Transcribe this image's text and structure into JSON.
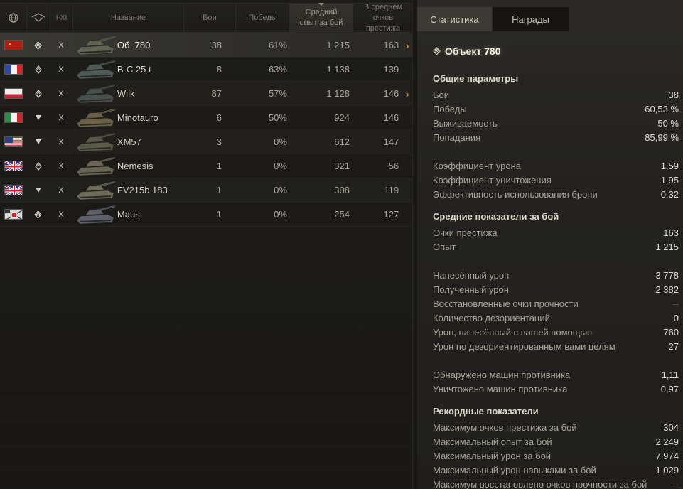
{
  "table": {
    "headers": {
      "nation_icon": "globe-icon",
      "type_icon": "vehicle-type-icon",
      "tier": "I-XI",
      "name": "Название",
      "battles": "Бои",
      "wins": "Победы",
      "avg_exp": "Средний опыт за бой",
      "avg_prestige": "В среднем очков престижа"
    },
    "rows": [
      {
        "nation": "ussr",
        "type": "heavy",
        "tier": "X",
        "name": "Об. 780",
        "battles": "38",
        "wins": "61%",
        "exp": "1 215",
        "prestige": "163",
        "arrow": "›"
      },
      {
        "nation": "france",
        "type": "medium",
        "tier": "X",
        "name": "B-C 25 t",
        "battles": "8",
        "wins": "63%",
        "exp": "1 138",
        "prestige": "139",
        "arrow": ""
      },
      {
        "nation": "poland",
        "type": "medium",
        "tier": "X",
        "name": "Wilk",
        "battles": "87",
        "wins": "57%",
        "exp": "1 128",
        "prestige": "146",
        "arrow": "›"
      },
      {
        "nation": "italy",
        "type": "td",
        "tier": "X",
        "name": "Minotauro",
        "battles": "6",
        "wins": "50%",
        "exp": "924",
        "prestige": "146",
        "arrow": ""
      },
      {
        "nation": "usa",
        "type": "td",
        "tier": "X",
        "name": "XM57",
        "battles": "3",
        "wins": "0%",
        "exp": "612",
        "prestige": "147",
        "arrow": ""
      },
      {
        "nation": "uk",
        "type": "medium",
        "tier": "X",
        "name": "Nemesis",
        "battles": "1",
        "wins": "0%",
        "exp": "321",
        "prestige": "56",
        "arrow": ""
      },
      {
        "nation": "uk",
        "type": "td",
        "tier": "X",
        "name": "FV215b 183",
        "battles": "1",
        "wins": "0%",
        "exp": "308",
        "prestige": "119",
        "arrow": ""
      },
      {
        "nation": "germany",
        "type": "heavy",
        "tier": "X",
        "name": "Maus",
        "battles": "1",
        "wins": "0%",
        "exp": "254",
        "prestige": "127",
        "arrow": ""
      }
    ]
  },
  "tabs": [
    {
      "label": "Статистика",
      "active": true
    },
    {
      "label": "Награды",
      "active": false
    }
  ],
  "vehicle": {
    "title": "Объект 780",
    "type_icon": "heavy-tank-icon"
  },
  "sections": {
    "general": "Общие параметры",
    "average": "Средние показатели за бой",
    "records": "Рекордные показатели"
  },
  "stats": {
    "battles": {
      "label": "Бои",
      "value": "38"
    },
    "wins": {
      "label": "Победы",
      "value": "60,53 %"
    },
    "survival": {
      "label": "Выживаемость",
      "value": "50 %"
    },
    "hits": {
      "label": "Попадания",
      "value": "85,99 %"
    },
    "damage_ratio": {
      "label": "Коэффициент урона",
      "value": "1,59"
    },
    "kill_ratio": {
      "label": "Коэффициент уничтожения",
      "value": "1,95"
    },
    "armor_eff": {
      "label": "Эффективность использования брони",
      "value": "0,32"
    },
    "prestige": {
      "label": "Очки престижа",
      "value": "163"
    },
    "exp": {
      "label": "Опыт",
      "value": "1 215"
    },
    "dmg_dealt": {
      "label": "Нанесённый урон",
      "value": "3 778"
    },
    "dmg_received": {
      "label": "Полученный урон",
      "value": "2 382"
    },
    "hp_restored": {
      "label": "Восстановленные очки прочности",
      "value": "--"
    },
    "stuns": {
      "label": "Количество дезориентаций",
      "value": "0"
    },
    "assist_dmg": {
      "label": "Урон, нанесённый с вашей помощью",
      "value": "760"
    },
    "stun_dmg": {
      "label": "Урон по дезориентированным вами целям",
      "value": "27"
    },
    "spotted": {
      "label": "Обнаружено машин противника",
      "value": "1,11"
    },
    "destroyed": {
      "label": "Уничтожено машин противника",
      "value": "0,97"
    },
    "max_prestige": {
      "label": "Максимум очков престижа за бой",
      "value": "304"
    },
    "max_exp": {
      "label": "Максимальный опыт за бой",
      "value": "2 249"
    },
    "max_dmg": {
      "label": "Максимальный урон за бой",
      "value": "7 974"
    },
    "max_skill_dmg": {
      "label": "Максимальный урон навыками за бой",
      "value": "1 029"
    },
    "max_hp_restored": {
      "label": "Максимум восстановлено очков прочности за бой",
      "value": "--"
    }
  },
  "colors": {
    "accent": "#e39a1f",
    "background": "#161512",
    "text": "#b9b5a6"
  }
}
